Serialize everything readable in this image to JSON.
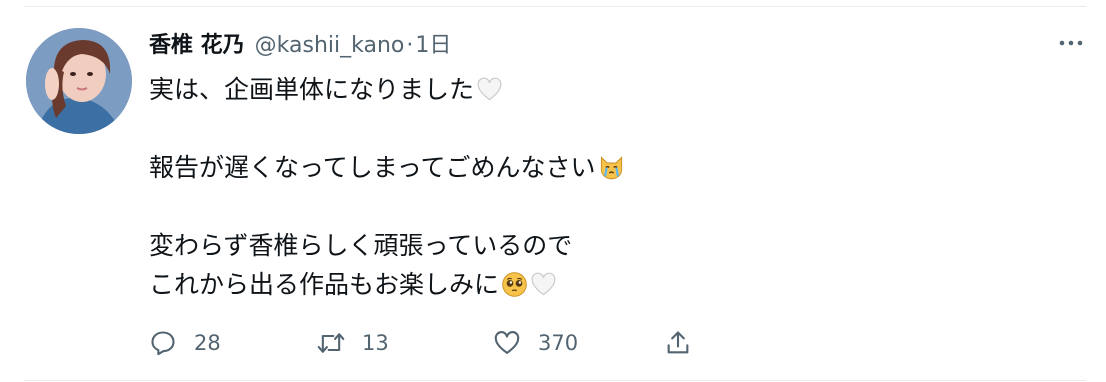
{
  "tweet": {
    "author_name": "香椎 花乃",
    "handle": "@kashii_kano",
    "separator": "·",
    "time": "1日",
    "lines": [
      "実は、企画単体になりました",
      "",
      "報告が遅くなってしまってごめんなさい",
      "",
      "変わらず香椎らしく頑張っているので",
      "これから出る作品もお楽しみに"
    ],
    "emojis": {
      "line1": [
        "white-heart-icon"
      ],
      "line3": [
        "crying-cat-icon"
      ],
      "line6": [
        "pleading-face-icon",
        "white-heart-icon"
      ]
    }
  },
  "actions": {
    "reply_count": "28",
    "retweet_count": "13",
    "like_count": "370"
  },
  "colors": {
    "text": "#0f1419",
    "secondary": "#536471",
    "divider": "#e6ecf0"
  }
}
